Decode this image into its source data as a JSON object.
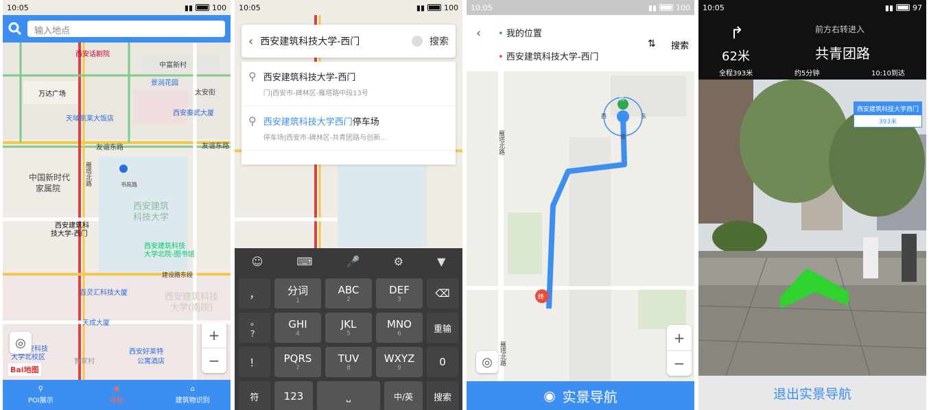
{
  "colors": {
    "accent": "#3c8ef0",
    "route": "#3c8ef0",
    "active_nav": "#ff6b4a",
    "ar_arrow": "#2fd22f"
  },
  "screen1": {
    "status": {
      "time": "10:05",
      "battery": "100"
    },
    "search": {
      "placeholder": "输入地点"
    },
    "map_labels": {
      "l1": "西安话剧院",
      "l2": "中富新村",
      "l3": "景润花园",
      "l4": "万达广场",
      "l5": "太安街",
      "l6": "天域凯莱大饭店",
      "l7": "西安秦武大厦",
      "l8": "友谊东路",
      "l9": "友谊东路",
      "l10": "中国新时代",
      "l11": "家属院",
      "l12": "雁塔北路",
      "l13": "书苑路",
      "l14": "西安建筑",
      "l15": "科技大学",
      "l16": "西安建筑科",
      "l17": "技大学-西门",
      "l18": "西安建筑科技",
      "l19": "大学北院-图书馆",
      "l20": "建设路东段",
      "l21": "百灵汇科技大厦",
      "l22": "西安建筑科技",
      "l23": "大学(南院)",
      "l24": "天成大厦",
      "l25": "西安好莱特",
      "l26": "公寓酒店",
      "l27": "鲁家村",
      "l28": "西安科技",
      "l29": "大学北校区"
    },
    "logo": "Bai地图",
    "nav": [
      {
        "label": "POI展示",
        "icon": "pin-icon"
      },
      {
        "label": "导航",
        "icon": "navigation-icon"
      },
      {
        "label": "建筑物识别",
        "icon": "building-icon"
      }
    ]
  },
  "screen2": {
    "status": {
      "time": "10:05",
      "battery": "100"
    },
    "search": {
      "query": "西安建筑科技大学-西门",
      "button": "搜索"
    },
    "suggestions": [
      {
        "title": "西安建筑科技大学-西门",
        "sub": "门|西安市-碑林区-雁塔路中段13号",
        "hl": "",
        "rest": ""
      },
      {
        "title": "",
        "hl": "西安建筑科技大学西门",
        "rest": "停车场",
        "sub": "停车场|西安市-碑林区-共青团路与创新..."
      }
    ],
    "keyboard": {
      "top": [
        "☺",
        "⌨",
        "🎤",
        "⚙",
        "▼"
      ],
      "left": [
        "，",
        "。",
        "？",
        "！"
      ],
      "rows": [
        [
          {
            "k": "分词",
            "s": "1"
          },
          {
            "k": "ABC",
            "s": "2"
          },
          {
            "k": "DEF",
            "s": "3"
          }
        ],
        [
          {
            "k": "GHI",
            "s": "4"
          },
          {
            "k": "JKL",
            "s": "5"
          },
          {
            "k": "MNO",
            "s": "6"
          }
        ],
        [
          {
            "k": "PQRS",
            "s": "7"
          },
          {
            "k": "TUV",
            "s": "8"
          },
          {
            "k": "WXYZ",
            "s": "9"
          }
        ]
      ],
      "right": [
        "⌫",
        "重输",
        "0"
      ],
      "bottom": {
        "sym": "符",
        "num": "123",
        "space": "",
        "lang": "中/英",
        "search": "搜索"
      }
    }
  },
  "screen3": {
    "status": {
      "time": "10:05",
      "battery": "100"
    },
    "route": {
      "from": "我的位置",
      "to": "西安建筑科技大学-西门",
      "search": "搜索"
    },
    "compass": {
      "n": "北",
      "w": "西",
      "e": "东",
      "s": "南"
    },
    "dest_marker": "终",
    "map_labels": {
      "r1": "雁塔北路",
      "r2": "雁塔北路"
    },
    "button": "实景导航"
  },
  "screen4": {
    "status": {
      "time": "10:05",
      "battery": "97"
    },
    "nav": {
      "next": "前方右转进入",
      "road": "共青团路",
      "distance": "62米",
      "total": "全程393米",
      "eta": "约5分钟",
      "arrive": "10:10到达"
    },
    "ar_label": {
      "name": "西安建筑科技大学西门",
      "dist": "393米"
    },
    "button": "退出实景导航"
  }
}
